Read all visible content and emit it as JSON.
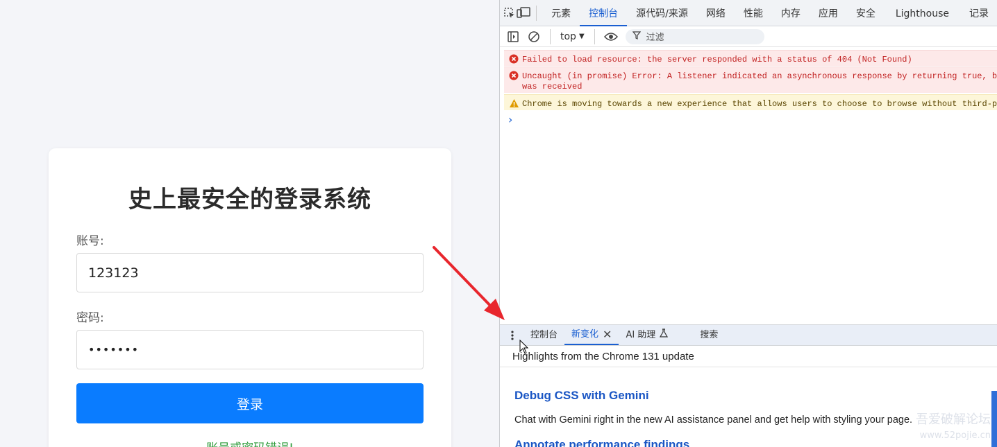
{
  "login_page": {
    "title": "史上最安全的登录系统",
    "account_label": "账号:",
    "account_value": "123123",
    "password_label": "密码:",
    "password_value": "•••••••",
    "login_button": "登录",
    "error_message": "账号或密码错误!"
  },
  "devtools": {
    "tabs": [
      "元素",
      "控制台",
      "源代码/来源",
      "网络",
      "性能",
      "内存",
      "应用",
      "安全",
      "Lighthouse",
      "记录"
    ],
    "active_tab": "控制台",
    "context": "top",
    "filter_placeholder": "过滤",
    "messages": [
      {
        "level": "error",
        "text": "Failed to load resource: the server responded with a status of 404 (Not Found)"
      },
      {
        "level": "error",
        "text": "Uncaught (in promise) Error: A listener indicated an asynchronous response by returning true, but",
        "text2": "was received"
      },
      {
        "level": "warning",
        "text": "Chrome is moving towards a new experience that allows users to choose to browse without third-part"
      }
    ],
    "drawer": {
      "tabs": [
        "控制台",
        "新变化",
        "AI 助理",
        "搜索"
      ],
      "active_tab": "新变化",
      "highlights": "Highlights from the Chrome 131 update",
      "features": [
        {
          "title": "Debug CSS with Gemini",
          "desc": "Chat with Gemini right in the new AI assistance panel and get help with styling your page."
        },
        {
          "title": "Annotate performance findings"
        }
      ]
    }
  },
  "watermark": {
    "line1": "吾爱破解论坛",
    "line2": "www.52pojie.cn"
  },
  "colors": {
    "login_button": "#0a7cff",
    "error_text": "#2e9b3a",
    "devtools_accent": "#1a5fd1",
    "arrow": "#e8262d"
  }
}
